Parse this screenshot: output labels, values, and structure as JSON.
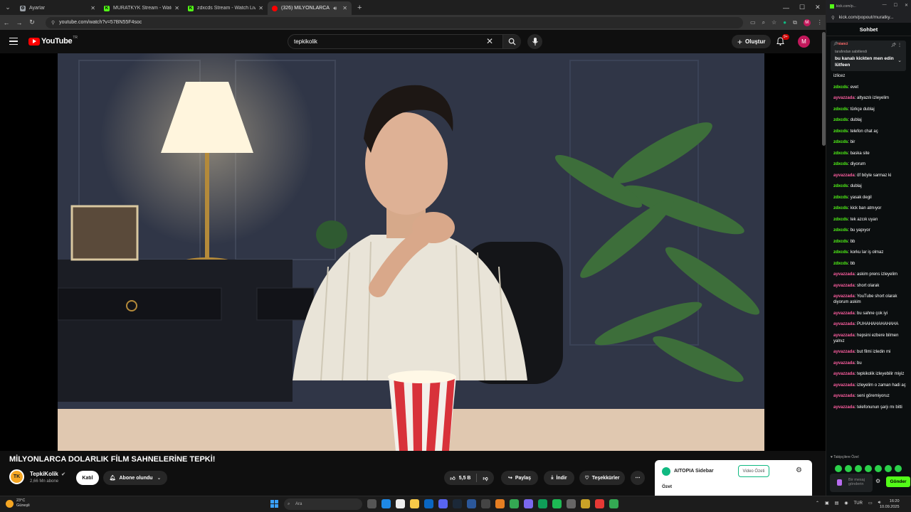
{
  "browser": {
    "tabs": [
      {
        "title": "Ayarlar",
        "favicon": "gear-icon",
        "color": "#9aa0a6"
      },
      {
        "title": "MURATKYK Stream - Watch Live on Kick",
        "favicon": "kick-icon",
        "color": "#53fc18"
      },
      {
        "title": "zdxcds Stream - Watch Live on Kick",
        "favicon": "kick-icon",
        "color": "#53fc18"
      },
      {
        "title": "(326) MİLYONLARCA DOLARLIK",
        "favicon": "youtube-icon",
        "color": "#ff0000"
      }
    ],
    "url": "youtube.com/watch?v=57BN55F4soc"
  },
  "youtube": {
    "logo_text": "YouTube",
    "country_code": "TR",
    "search_query": "tepkikolik",
    "create_label": "Oluştur",
    "notif_count": "9+",
    "avatar_letter": "M",
    "video": {
      "title": "MİLYONLARCA DOLARLIK FİLM SAHNELERİNE TEPKİ!",
      "channel_name": "TepkiKolik",
      "channel_initials": "TK",
      "subscribers": "2,66 Mn abone",
      "join_label": "Katıl",
      "subscribed_label": "Abone olundu",
      "likes": "5,5 B",
      "share_label": "Paylaş",
      "download_label": "İndir",
      "thanks_label": "Teşekkürler"
    }
  },
  "aitopia": {
    "name": "AITOPIA Sidebar",
    "video_summary_label": "Video Özeti",
    "summary_heading": "Özet"
  },
  "kick": {
    "window_title": "kick.com/p...",
    "url": "kick.com/popout/muratky...",
    "header": "Sohbet",
    "pinned": {
      "user": "nianci",
      "pinned_by": "tarafından sabitlendi",
      "message": "bu kanalı kickten men edin lütfeen"
    },
    "messages": [
      {
        "user": "",
        "text": "izlicez",
        "color": "g"
      },
      {
        "user": "zdxcds",
        "text": "evet",
        "color": "g"
      },
      {
        "user": "ayvazzada",
        "text": "altyazılı izleyelim",
        "color": "p"
      },
      {
        "user": "zdxcds",
        "text": "türkçe dublaj",
        "color": "g"
      },
      {
        "user": "zdxcds",
        "text": "dublaj",
        "color": "g"
      },
      {
        "user": "zdxcds",
        "text": "telefon chat aç",
        "color": "g"
      },
      {
        "user": "zdxcds",
        "text": "bir",
        "color": "g"
      },
      {
        "user": "zdxcds",
        "text": "baska site",
        "color": "g"
      },
      {
        "user": "zdxcds",
        "text": "diyorum",
        "color": "g"
      },
      {
        "user": "ayvazzada",
        "text": "öf böyle sarmaz ki",
        "color": "p"
      },
      {
        "user": "zdxcds",
        "text": "dublaj",
        "color": "g"
      },
      {
        "user": "zdxcds",
        "text": "yasak degil",
        "color": "g"
      },
      {
        "user": "zdxcds",
        "text": "kick ban atmıyor",
        "color": "g"
      },
      {
        "user": "zdxcds",
        "text": "tek azcık uyarı",
        "color": "g"
      },
      {
        "user": "zdxcds",
        "text": "bu yapıyor",
        "color": "g"
      },
      {
        "user": "zdxcds",
        "text": "bb",
        "color": "g"
      },
      {
        "user": "zdxcds",
        "text": "korku lar iş olmaz",
        "color": "g"
      },
      {
        "user": "zdxcds",
        "text": "bb",
        "color": "g"
      },
      {
        "user": "ayvazzada",
        "text": "askim prens izleyelim",
        "color": "p"
      },
      {
        "user": "ayvazzada",
        "text": "short olarak",
        "color": "p"
      },
      {
        "user": "ayvazzada",
        "text": "YouTube short olarak diyorum askim",
        "color": "p"
      },
      {
        "user": "ayvazzada",
        "text": "bu sahne çok iyi",
        "color": "p"
      },
      {
        "user": "ayvazzada",
        "text": "PUHAHAHAHAHAHA",
        "color": "p"
      },
      {
        "user": "ayvazzada",
        "text": "hepsini ezbere bilmen yalnız",
        "color": "p"
      },
      {
        "user": "ayvazzada",
        "text": "but filmi izledin mi",
        "color": "p"
      },
      {
        "user": "ayvazzada",
        "text": "bu",
        "color": "p"
      },
      {
        "user": "ayvazzada",
        "text": "tepkikolik izleyebilir miyiz",
        "color": "p"
      },
      {
        "user": "ayvazzada",
        "text": "izleyelim o zaman hadi aç",
        "color": "p"
      },
      {
        "user": "ayvazzada",
        "text": "seni göremiyoruz",
        "color": "p"
      },
      {
        "user": "ayvazzada",
        "text": "telefonunun şarjı mı bitti",
        "color": "p"
      }
    ],
    "followers_only": "Takipçilere Özel",
    "input_placeholder": "Bir mesaj gönderin",
    "send_label": "Gönder"
  },
  "taskbar": {
    "weather_temp": "23°C",
    "weather_text": "Güneşli",
    "search_placeholder": "Ara",
    "lang": "TUR",
    "time": "16:20",
    "date": "10.09.2025"
  }
}
